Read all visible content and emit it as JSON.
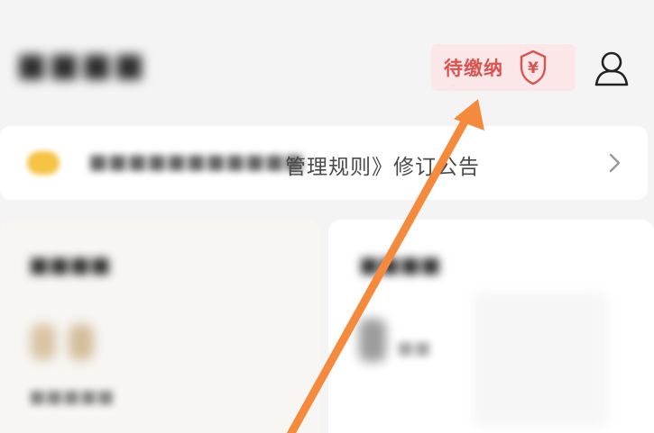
{
  "header": {
    "pending_label": "待缴纳",
    "shield_symbol": "¥",
    "icons": [
      "shield-yen-icon",
      "user-icon"
    ]
  },
  "notice": {
    "text": "管理规则》修订公告",
    "icon": "chevron-right-icon"
  },
  "colors": {
    "accent_red": "#d9534f",
    "badge_bg": "#fbe7e7",
    "arrow_orange": "#f58a3c",
    "notice_dot": "#f6c343"
  }
}
